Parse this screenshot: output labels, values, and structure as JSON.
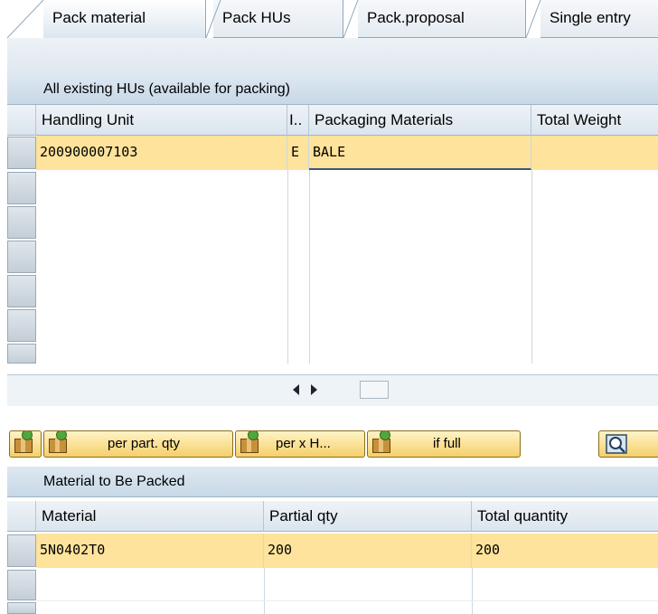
{
  "tabs": [
    {
      "label": "Pack material",
      "active": true
    },
    {
      "label": "Pack HUs",
      "active": false
    },
    {
      "label": "Pack.proposal",
      "active": false
    },
    {
      "label": "Single entry",
      "active": false
    }
  ],
  "hu_section": {
    "title": "All existing HUs (available for packing)",
    "columns": [
      "Handling Unit",
      "I..",
      "Packaging Materials",
      "Total Weight"
    ],
    "rows": [
      {
        "handling_unit": "200900007103",
        "indicator": "E",
        "packaging_material": "BALE",
        "total_weight": ""
      }
    ]
  },
  "toolbar": {
    "per_part_qty": "per part. qty",
    "per_x_hu": "per x H...",
    "if_full": "if full"
  },
  "material_section": {
    "title": "Material to Be Packed",
    "columns": [
      "Material",
      "Partial qty",
      "Total quantity"
    ],
    "rows": [
      {
        "material": "5N0402T0",
        "partial_qty": "200",
        "total_quantity": "200"
      }
    ]
  },
  "colors": {
    "selected_row": "#fde39b",
    "header_bg": "#dbe5ee",
    "section_title_bg": "#c8d8e6",
    "button_bg": "#f5d06a"
  }
}
